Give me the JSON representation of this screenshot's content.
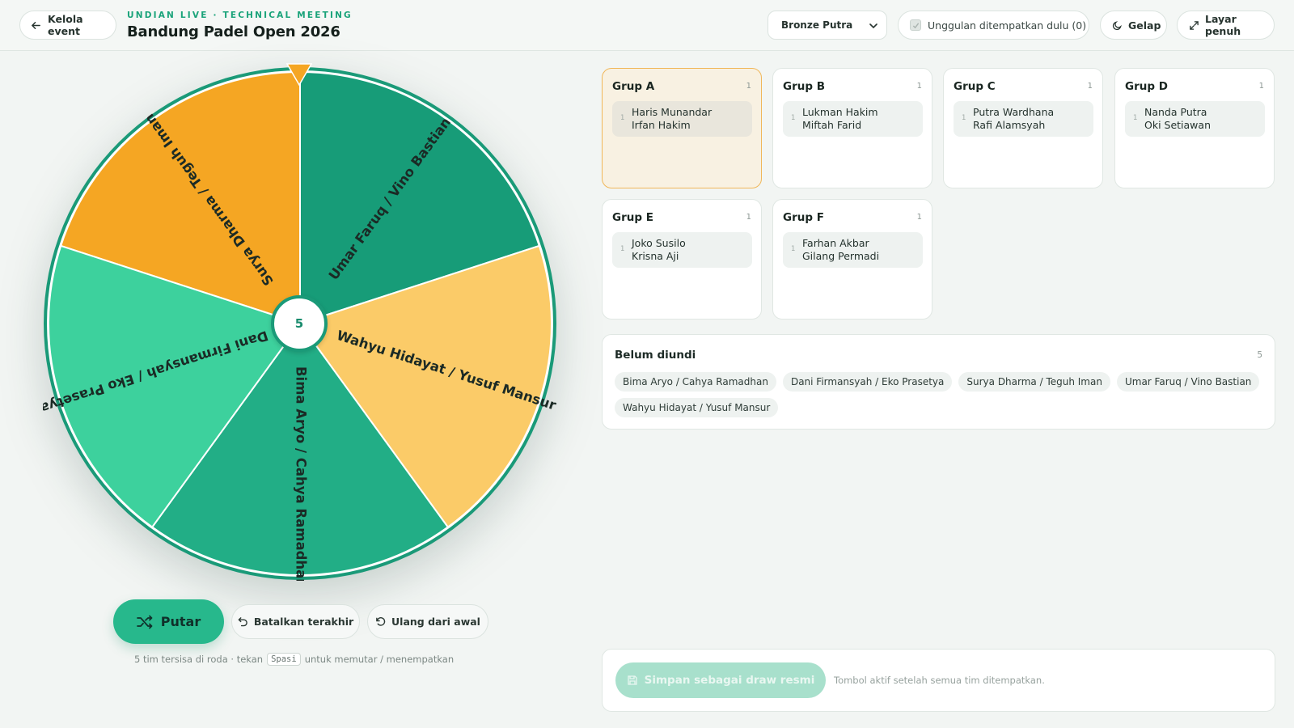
{
  "header": {
    "back_label": "Kelola event",
    "kicker": "UNDIAN LIVE · TECHNICAL MEETING",
    "title": "Bandung Padel Open 2026",
    "category_selected": "Bronze Putra",
    "seed_label": "Unggulan ditempatkan dulu (0)",
    "dark_label": "Gelap",
    "fullscreen_label": "Layar penuh"
  },
  "wheel": {
    "remaining": "5",
    "segments": [
      {
        "label": "Surya Dharma / Teguh Iman",
        "color": "#f5a623"
      },
      {
        "label": "Umar Faruq / Vino Bastian",
        "color": "#179c78"
      },
      {
        "label": "Wahyu Hidayat / Yusuf Mansur",
        "color": "#fbcb68"
      },
      {
        "label": "Bima Aryo / Cahya Ramadhan",
        "color": "#22ae86"
      },
      {
        "label": "Dani Firmansyah / Eko Prasetya",
        "color": "#3dd19d"
      }
    ],
    "rim_color": "#1a9a78",
    "pointer_color": "#f5a623"
  },
  "controls": {
    "spin_label": "Putar",
    "undo_label": "Batalkan terakhir",
    "reset_label": "Ulang dari awal",
    "hint_before": "5 tim tersisa di roda · tekan",
    "hint_key": "Spasi",
    "hint_after": "untuk memutar / menempatkan"
  },
  "groups": [
    {
      "name": "Grup A",
      "count": "1",
      "slot_no": "1",
      "team": "Haris Munandar\nIrfan Hakim"
    },
    {
      "name": "Grup B",
      "count": "1",
      "slot_no": "1",
      "team": "Lukman Hakim\nMiftah Farid"
    },
    {
      "name": "Grup C",
      "count": "1",
      "slot_no": "1",
      "team": "Putra Wardhana\nRafi Alamsyah"
    },
    {
      "name": "Grup D",
      "count": "1",
      "slot_no": "1",
      "team": "Nanda Putra\nOki Setiawan"
    },
    {
      "name": "Grup E",
      "count": "1",
      "slot_no": "1",
      "team": "Joko Susilo\nKrisna Aji"
    },
    {
      "name": "Grup F",
      "count": "1",
      "slot_no": "1",
      "team": "Farhan Akbar\nGilang Permadi"
    }
  ],
  "pool": {
    "title": "Belum diundi",
    "count": "5",
    "teams": [
      "Bima Aryo / Cahya Ramadhan",
      "Dani Firmansyah / Eko Prasetya",
      "Surya Dharma / Teguh Iman",
      "Umar Faruq / Vino Bastian",
      "Wahyu Hidayat / Yusuf Mansur"
    ]
  },
  "save": {
    "label": "Simpan sebagai draw resmi",
    "note": "Tombol aktif setelah semua tim ditempatkan."
  }
}
